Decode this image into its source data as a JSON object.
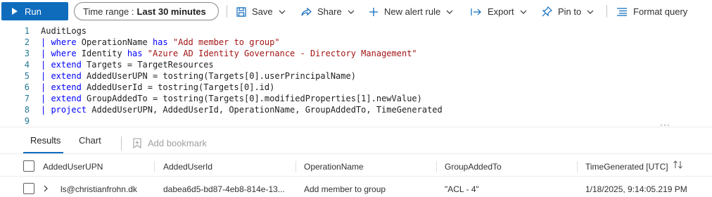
{
  "toolbar": {
    "run_label": "Run",
    "time_range_label": "Time range :",
    "time_range_value": "Last 30 minutes",
    "save_label": "Save",
    "share_label": "Share",
    "new_alert_rule_label": "New alert rule",
    "export_label": "Export",
    "pin_to_label": "Pin to",
    "format_query_label": "Format query"
  },
  "editor": {
    "lines": [
      {
        "n": "1",
        "parts": [
          {
            "t": "AuditLogs",
            "c": "plain"
          }
        ]
      },
      {
        "n": "2",
        "parts": [
          {
            "t": "| ",
            "c": "pipe"
          },
          {
            "t": "where",
            "c": "kw"
          },
          {
            "t": " OperationName ",
            "c": "plain"
          },
          {
            "t": "has",
            "c": "kw"
          },
          {
            "t": " ",
            "c": "plain"
          },
          {
            "t": "\"Add member to group\"",
            "c": "str"
          }
        ]
      },
      {
        "n": "3",
        "parts": [
          {
            "t": "| ",
            "c": "pipe"
          },
          {
            "t": "where",
            "c": "kw"
          },
          {
            "t": " Identity ",
            "c": "plain"
          },
          {
            "t": "has",
            "c": "kw"
          },
          {
            "t": " ",
            "c": "plain"
          },
          {
            "t": "\"Azure AD Identity Governance - Directory Management\"",
            "c": "str"
          }
        ]
      },
      {
        "n": "4",
        "parts": [
          {
            "t": "| ",
            "c": "pipe"
          },
          {
            "t": "extend",
            "c": "kw"
          },
          {
            "t": " Targets = TargetResources",
            "c": "plain"
          }
        ]
      },
      {
        "n": "5",
        "parts": [
          {
            "t": "| ",
            "c": "pipe"
          },
          {
            "t": "extend",
            "c": "kw"
          },
          {
            "t": " AddedUserUPN = tostring(Targets[0].userPrincipalName)",
            "c": "plain"
          }
        ]
      },
      {
        "n": "6",
        "parts": [
          {
            "t": "| ",
            "c": "pipe"
          },
          {
            "t": "extend",
            "c": "kw"
          },
          {
            "t": " AddedUserId = tostring(Targets[0].id)",
            "c": "plain"
          }
        ]
      },
      {
        "n": "7",
        "parts": [
          {
            "t": "| ",
            "c": "pipe"
          },
          {
            "t": "extend",
            "c": "kw"
          },
          {
            "t": " GroupAddedTo = tostring(Targets[0].modifiedProperties[1].newValue)",
            "c": "plain"
          }
        ]
      },
      {
        "n": "8",
        "parts": [
          {
            "t": "| ",
            "c": "pipe"
          },
          {
            "t": "project",
            "c": "kw"
          },
          {
            "t": " AddedUserUPN, AddedUserId, OperationName, GroupAddedTo, TimeGenerated",
            "c": "plain"
          }
        ]
      },
      {
        "n": "9",
        "parts": []
      }
    ]
  },
  "results": {
    "tabs": [
      "Results",
      "Chart"
    ],
    "add_bookmark_label": "Add bookmark",
    "columns": [
      "AddedUserUPN",
      "AddedUserId",
      "OperationName",
      "GroupAddedTo",
      "TimeGenerated [UTC]"
    ],
    "rows": [
      {
        "AddedUserUPN": "ls@christianfrohn.dk",
        "AddedUserId": "dabea6d5-bd87-4eb8-814e-13...",
        "OperationName": "Add member to group",
        "GroupAddedTo": "\"ACL - 4\"",
        "TimeGenerated": "1/18/2025, 9:14:05.219 PM"
      }
    ]
  },
  "colors": {
    "accent": "#0f6cbd",
    "keyword": "#0000ff",
    "string": "#a31515",
    "line_number": "#237893"
  }
}
